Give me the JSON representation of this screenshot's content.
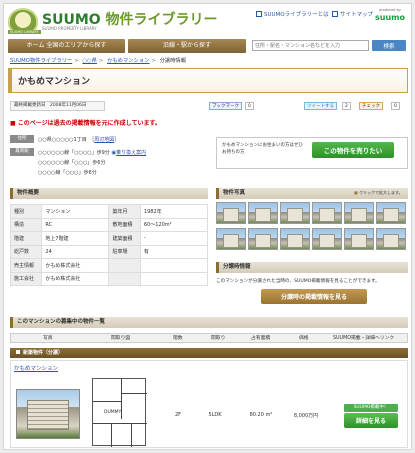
{
  "header": {
    "brand": "SUUMO",
    "brand_suffix": "物件ライブラリー",
    "brand_tagline": "SUUMO PROPERTY LIBRARY",
    "brand_ribbon": "SUUMO LIBRARY",
    "links": [
      "SUUMOライブラリーとは",
      "サイトマップ"
    ],
    "produced_by": "produced by",
    "produced_brand": "suumo"
  },
  "nav": {
    "items": [
      "ホーム  全国のエリアから探す",
      "沿線・駅から探す"
    ],
    "search_placeholder": "住所・駅名・マンション名などを入力",
    "search_button": "検索"
  },
  "breadcrumb": {
    "items": [
      "SUUMO物件ライブラリー",
      "○○県",
      "かもめマンション"
    ],
    "current": "分譲時情報"
  },
  "page": {
    "title": "かもめマンション",
    "meta_label": "最終掲載更新日",
    "meta_value": "2008年11月06日",
    "social": [
      "ブックマーク",
      "0",
      "ツイートする",
      "2",
      "チェック",
      "0"
    ],
    "notice": "このページは過去の掲載情報を元に作成しています。"
  },
  "address": {
    "label_address": "住所",
    "address": "○○県○○○○○1丁目",
    "map_link": "周辺地図",
    "label_station": "最寄駅",
    "stations": [
      "○○○○○○線「○○○○」歩9分",
      "○○○○○○線「○○○」歩6分",
      "○○○○線「○○○」歩6分"
    ],
    "station_link": "乗り換え案内"
  },
  "sell": {
    "text": "かもめマンションにお住まいの方はぜひお持ちの方",
    "button": "この物件を売りたい"
  },
  "overview": {
    "header": "物件概要",
    "rows": [
      [
        "種別",
        "マンション",
        "築年月",
        "1982年"
      ],
      [
        "構造",
        "RC",
        "敷地面積",
        "60～120m²"
      ],
      [
        "階建",
        "地上7階建",
        "建築面積",
        "-"
      ],
      [
        "総戸数",
        "24",
        "駐車場",
        "有"
      ],
      [
        "売主情報",
        "かもめ株式会社",
        "",
        ""
      ],
      [
        "施工会社",
        "かもめ株式会社",
        "",
        ""
      ]
    ]
  },
  "photos": {
    "header": "物件写真",
    "hint": "クリックで拡大します。",
    "count": 12
  },
  "period": {
    "header": "分譲時情報",
    "text": "このマンションが分譲された当時の、SUUMO掲載情報を見ることができます。",
    "button": "分譲時の掲載情報を見る"
  },
  "listing": {
    "header": "このマンションの募集中の物件一覧",
    "columns": [
      "写真",
      "間取り図",
      "階数",
      "間取り",
      "占有面積",
      "価格",
      "SUUMO掲載・詳細へリンク"
    ],
    "category": "新築物件（分譲）",
    "building_link": "かもめマンション",
    "floor_plan_label": "DUMMY",
    "row": {
      "floor": "2F",
      "layout": "5LDK",
      "area": "80.20 m²",
      "price": "8,000万円",
      "badge": "SUUMO掲載中！",
      "button": "詳細を見る"
    }
  },
  "colors": {
    "accent_brown": "#8a6c34",
    "green_button": "#2f8f2a",
    "link_blue": "#2a56a8",
    "notice_red": "#cc0000"
  }
}
